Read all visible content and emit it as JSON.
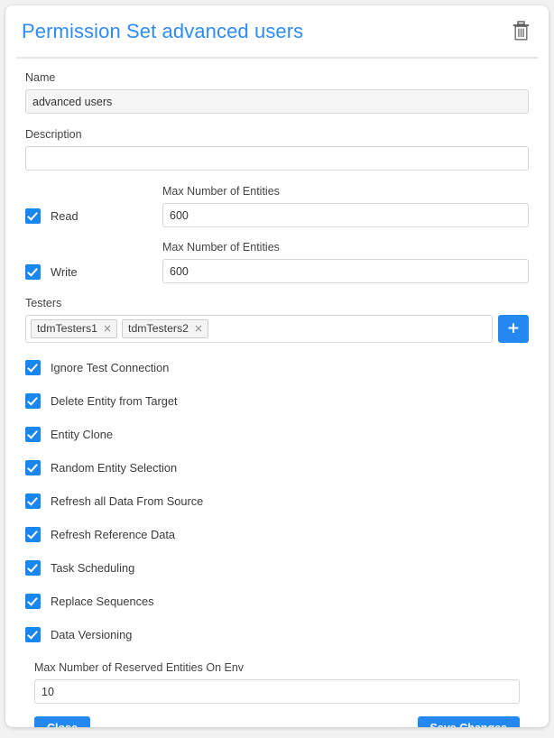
{
  "header": {
    "title": "Permission Set advanced users",
    "delete_icon": "trash-icon",
    "title_color": "#2d8cf7"
  },
  "form": {
    "name": {
      "label": "Name",
      "value": "advanced users",
      "placeholder": ""
    },
    "description": {
      "label": "Description",
      "value": "",
      "placeholder": ""
    },
    "permissions": [
      {
        "key": "read",
        "label": "Read",
        "checked": true,
        "entities_label": "Max Number of Entities",
        "entities_value": "600"
      },
      {
        "key": "write",
        "label": "Write",
        "checked": true,
        "entities_label": "Max Number of Entities",
        "entities_value": "600"
      }
    ],
    "testers": {
      "label": "Testers",
      "chips": [
        "tdmTesters1",
        "tdmTesters2"
      ],
      "remove_glyph": "×",
      "add_label": "+"
    },
    "options": [
      {
        "label": "Ignore Test Connection",
        "checked": true
      },
      {
        "label": "Delete Entity from Target",
        "checked": true
      },
      {
        "label": "Entity Clone",
        "checked": true
      },
      {
        "label": "Random Entity Selection",
        "checked": true
      },
      {
        "label": "Refresh all Data From Source",
        "checked": true
      },
      {
        "label": "Refresh Reference Data",
        "checked": true
      },
      {
        "label": "Task Scheduling",
        "checked": true
      },
      {
        "label": "Replace Sequences",
        "checked": true
      },
      {
        "label": "Data Versioning",
        "checked": true
      }
    ],
    "reserved": {
      "label": "Max Number of Reserved Entities On Env",
      "value": "10",
      "placeholder": ""
    }
  },
  "footer": {
    "close_label": "Close",
    "save_label": "Save Changes",
    "button_color": "#2388f0"
  }
}
